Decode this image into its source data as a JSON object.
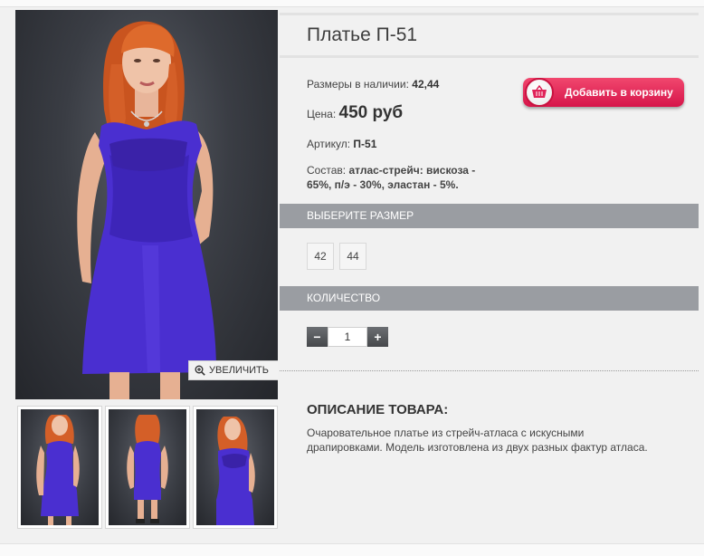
{
  "product": {
    "title": "Платье П-51",
    "sizes_label": "Размеры в наличии:",
    "sizes_value": "42,44",
    "price_label": "Цена:",
    "price_value": "450 руб",
    "article_label": "Артикул:",
    "article_value": "П-51",
    "composition_label": "Состав:",
    "composition_value": "атлас-стрейч: вискоза - 65%, п/э - 30%, эластан - 5%."
  },
  "cart": {
    "button_label": "Добавить в корзину",
    "icon": "basket-icon",
    "color": "#e0245a"
  },
  "gallery": {
    "zoom_label": "УВЕЛИЧИТЬ",
    "zoom_icon": "magnifier-plus-icon",
    "thumbnails": [
      "front-view",
      "back-view",
      "side-view"
    ]
  },
  "size_selector": {
    "heading": "ВЫБЕРИТЕ РАЗМЕР",
    "options": [
      "42",
      "44"
    ]
  },
  "quantity": {
    "heading": "КОЛИЧЕСТВО",
    "minus": "−",
    "plus": "+",
    "value": "1"
  },
  "description": {
    "heading": "ОПИСАНИЕ ТОВАРА:",
    "text": "Очаровательное платье из стрейч-атласа с искусными драпировками. Модель изготовлена из двух разных фактур атласа."
  },
  "colors": {
    "dress": "#4a2fd0",
    "hair": "#d9622a",
    "section_bar": "#9a9da2",
    "background": "#f1f1f1"
  }
}
